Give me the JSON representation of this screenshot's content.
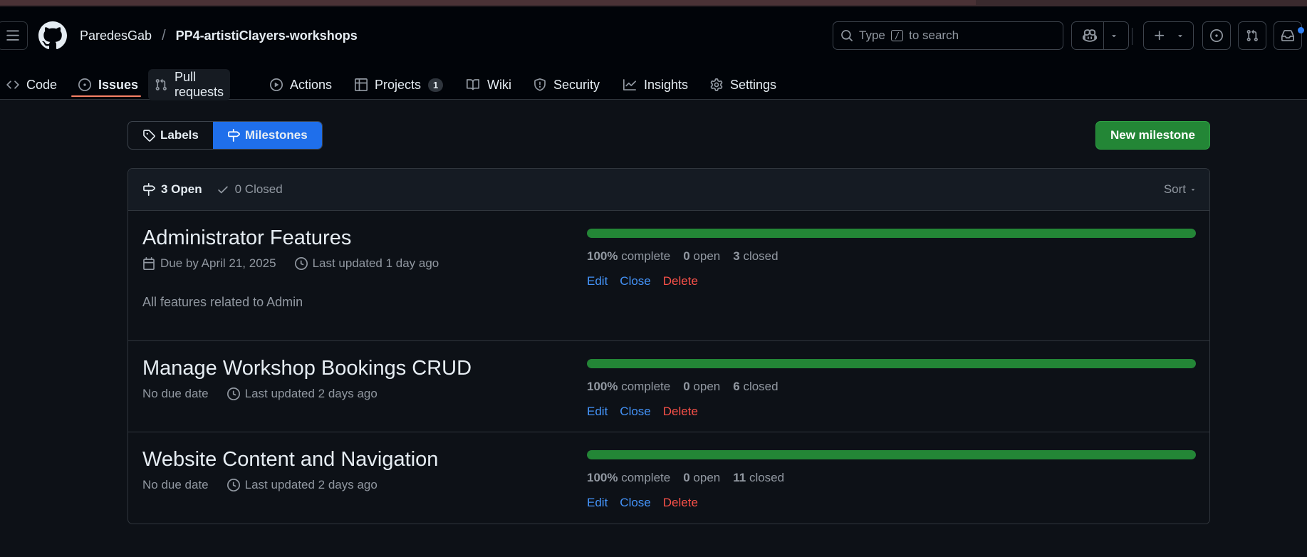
{
  "header": {
    "owner": "ParedesGab",
    "separator": "/",
    "repo": "PP4-artistiClayers-workshops",
    "search": {
      "prefix": "Type",
      "key": "/",
      "suffix": "to search"
    }
  },
  "tabs": [
    {
      "label": "Code",
      "icon": "code-icon"
    },
    {
      "label": "Issues",
      "icon": "issue-opened-icon",
      "active": true
    },
    {
      "label": "Pull requests",
      "icon": "git-pull-request-icon"
    },
    {
      "label": "Actions",
      "icon": "play-icon"
    },
    {
      "label": "Projects",
      "icon": "table-icon",
      "counter": "1"
    },
    {
      "label": "Wiki",
      "icon": "book-icon"
    },
    {
      "label": "Security",
      "icon": "shield-icon"
    },
    {
      "label": "Insights",
      "icon": "graph-icon"
    },
    {
      "label": "Settings",
      "icon": "gear-icon"
    }
  ],
  "subnav": {
    "labels": "Labels",
    "milestones": "Milestones"
  },
  "new_milestone": "New milestone",
  "list_header": {
    "open": "3 Open",
    "closed": "0 Closed",
    "sort": "Sort"
  },
  "milestones": [
    {
      "title": "Administrator Features",
      "due": "Due by April 21, 2025",
      "updated": "Last updated 1 day ago",
      "description": "All features related to Admin",
      "progress": 1.0,
      "percent": "100%",
      "complete_label": "complete",
      "open_count": "0",
      "open_label": "open",
      "closed_count": "3",
      "closed_label": "closed"
    },
    {
      "title": "Manage Workshop Bookings CRUD",
      "due": "No due date",
      "updated": "Last updated 2 days ago",
      "progress": 1.0,
      "percent": "100%",
      "complete_label": "complete",
      "open_count": "0",
      "open_label": "open",
      "closed_count": "6",
      "closed_label": "closed"
    },
    {
      "title": "Website Content and Navigation",
      "due": "No due date",
      "updated": "Last updated 2 days ago",
      "progress": 1.0,
      "percent": "100%",
      "complete_label": "complete",
      "open_count": "0",
      "open_label": "open",
      "closed_count": "11",
      "closed_label": "closed"
    }
  ],
  "actions": {
    "edit": "Edit",
    "close": "Close",
    "delete": "Delete"
  },
  "colors": {
    "accent": "#1f6feb",
    "success": "#238636",
    "danger": "#f85149",
    "link": "#4493f8",
    "tab_underline": "#f78166"
  }
}
